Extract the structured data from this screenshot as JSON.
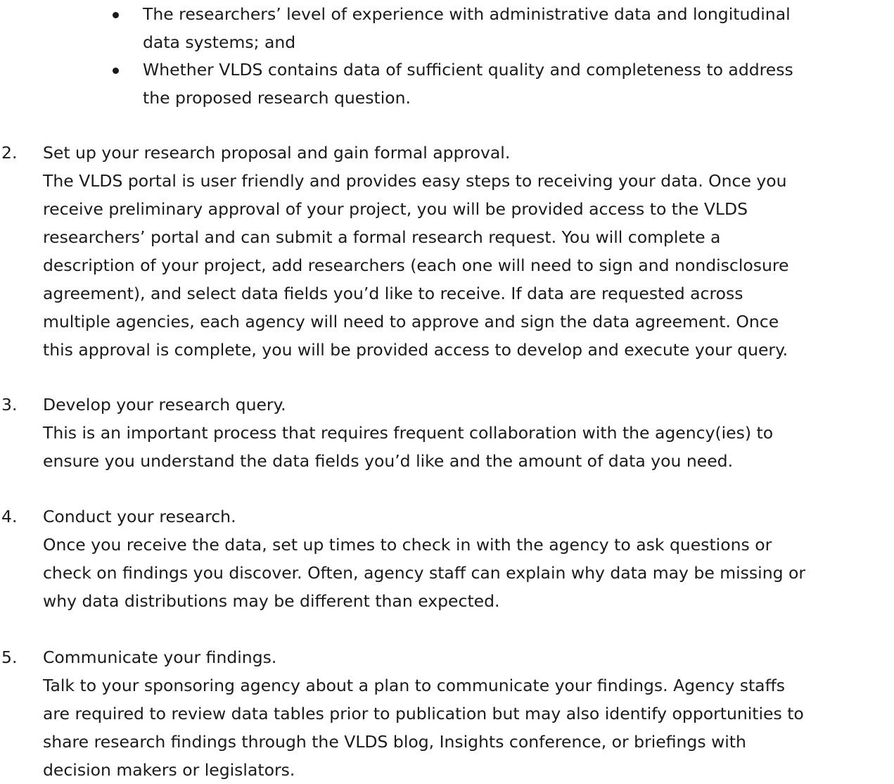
{
  "bullets": [
    {
      "text": "The researchers’ level of experience with administrative data and longitudinal\ndata systems; and"
    },
    {
      "text": "Whether VLDS contains data of sufficient quality and completeness to address\nthe proposed research question."
    }
  ],
  "steps": [
    {
      "number": "2.",
      "heading": "Set up your research proposal and gain formal approval.",
      "body": "The VLDS portal is user friendly and provides easy steps to receiving your data.  Once you\nreceive preliminary approval of your project, you will be provided access to the VLDS\nresearchers’ portal and can submit a formal research request. You will complete a\ndescription of your project, add researchers (each one will need to sign and nondisclosure\nagreement), and select data fields you’d like to receive. If data are requested across\nmultiple agencies, each agency will need to approve and sign the data agreement.  Once\nthis approval is complete, you will be provided access to develop and execute your query."
    },
    {
      "number": "3.",
      "heading": "Develop your research query.",
      "body": "This is an important process that requires frequent collaboration with the agency(ies) to\nensure you understand the data fields you’d like and the amount of data you need."
    },
    {
      "number": "4.",
      "heading": "Conduct your research.",
      "body": "Once you receive the data, set up times to check in with the agency to ask questions or\ncheck on findings you discover. Often, agency staff can explain why data may be missing or\nwhy data distributions may be different than expected."
    },
    {
      "number": "5.",
      "heading": "Communicate your findings.",
      "body": "Talk to your sponsoring agency about a plan to communicate your findings.  Agency staffs\nare required to review data tables prior to publication but may also identify opportunities to\nshare research findings through the VLDS blog, Insights conference, or briefings with\ndecision makers or legislators."
    }
  ]
}
